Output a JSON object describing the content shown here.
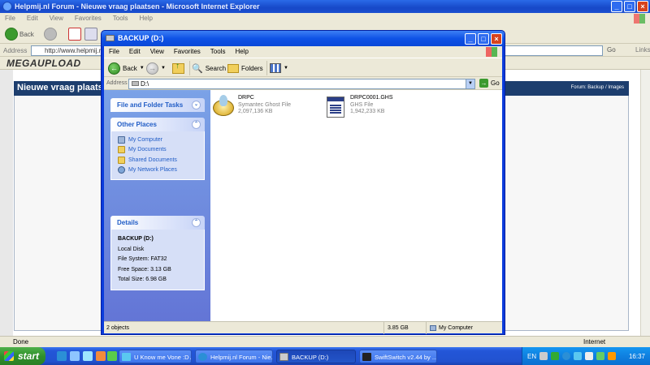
{
  "ie": {
    "title": "Helpmij.nl Forum - Nieuwe vraag plaatsen - Microsoft Internet Explorer",
    "menu": [
      "File",
      "Edit",
      "View",
      "Favorites",
      "Tools",
      "Help"
    ],
    "back_label": "Back",
    "address_label": "Address",
    "address_value": "http://www.helpmij.nl/foru",
    "go_label": "Go",
    "links_label": "Links",
    "toolbar_brand": "MEGAUPLOAD",
    "forum_title": "Nieuwe vraag plaatsen",
    "forum_breadcrumb": "Forum: Backup / Images",
    "status_text": "Done",
    "status_zone": "Internet"
  },
  "explorer": {
    "title": "BACKUP (D:)",
    "menu": [
      "File",
      "Edit",
      "View",
      "Favorites",
      "Tools",
      "Help"
    ],
    "toolbar": {
      "back": "Back",
      "search": "Search",
      "folders": "Folders"
    },
    "address_label": "Address",
    "address_value": "D:\\",
    "go_label": "Go",
    "tasks": {
      "file_folder_tasks": "File and Folder Tasks",
      "other_places_title": "Other Places",
      "other_places": [
        "My Computer",
        "My Documents",
        "Shared Documents",
        "My Network Places"
      ],
      "details_title": "Details",
      "details": {
        "name": "BACKUP (D:)",
        "type": "Local Disk",
        "fs": "File System: FAT32",
        "free": "Free Space: 3.13 GB",
        "total": "Total Size: 6.98 GB"
      }
    },
    "files": [
      {
        "name": "DRPC",
        "type": "Symantec Ghost File",
        "size": "2,097,136 KB"
      },
      {
        "name": "DRPC0001.GHS",
        "type": "GHS File",
        "size": "1,942,233 KB"
      }
    ],
    "status": {
      "objects": "2 objects",
      "size": "3.85 GB",
      "location": "My Computer"
    }
  },
  "taskbar": {
    "start": "start",
    "buttons": [
      "U Know me Vone :D A...",
      "Helpmij.nl Forum - Nie...",
      "BACKUP (D:)",
      "SwiftSwitch v2.44 by ..."
    ],
    "language": "EN",
    "clock": "16:37"
  }
}
